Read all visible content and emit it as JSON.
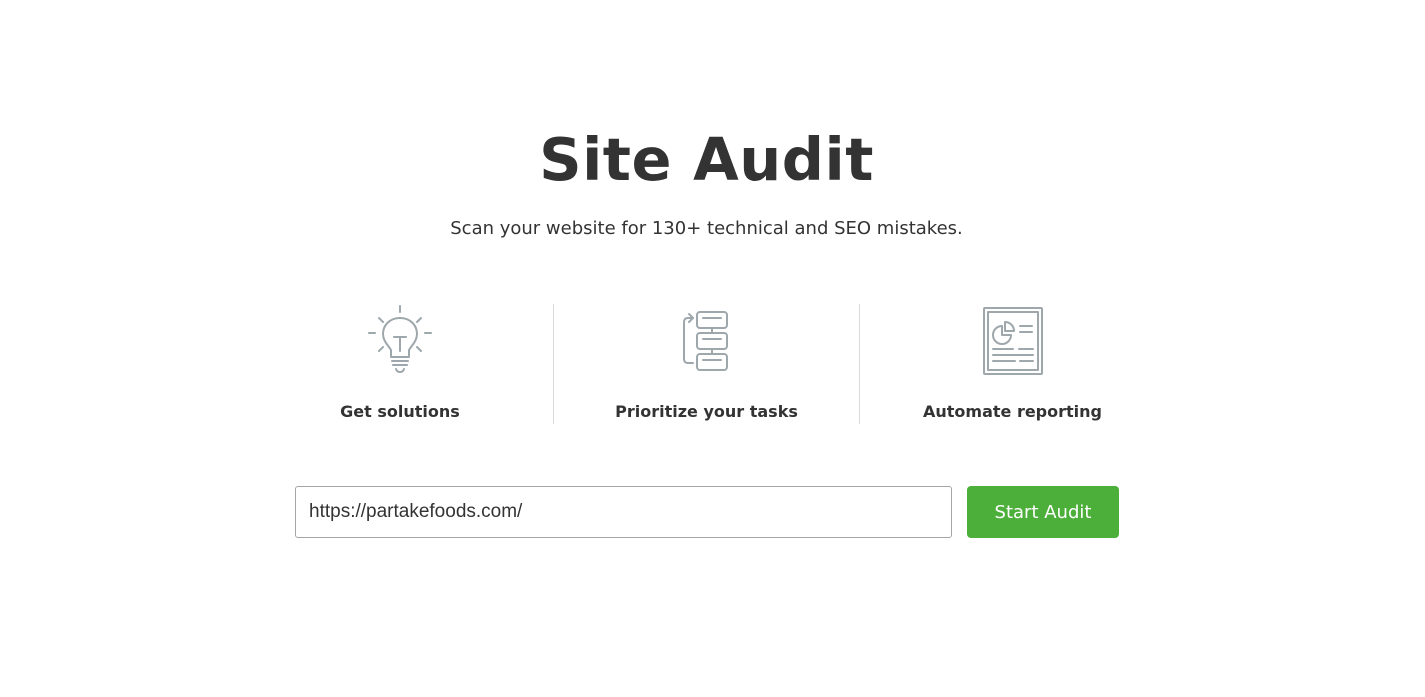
{
  "header": {
    "title": "Site Audit",
    "subtitle": "Scan your website for 130+ technical and SEO mistakes."
  },
  "features": [
    {
      "label": "Get solutions",
      "icon": "lightbulb-icon"
    },
    {
      "label": "Prioritize your tasks",
      "icon": "task-flow-icon"
    },
    {
      "label": "Automate reporting",
      "icon": "report-document-icon"
    }
  ],
  "form": {
    "url_value": "https://partakefoods.com/",
    "submit_label": "Start Audit"
  },
  "colors": {
    "accent": "#4caf3a",
    "icon_stroke": "#9ea7ab",
    "text": "#333333",
    "divider": "#d9d9d9"
  }
}
